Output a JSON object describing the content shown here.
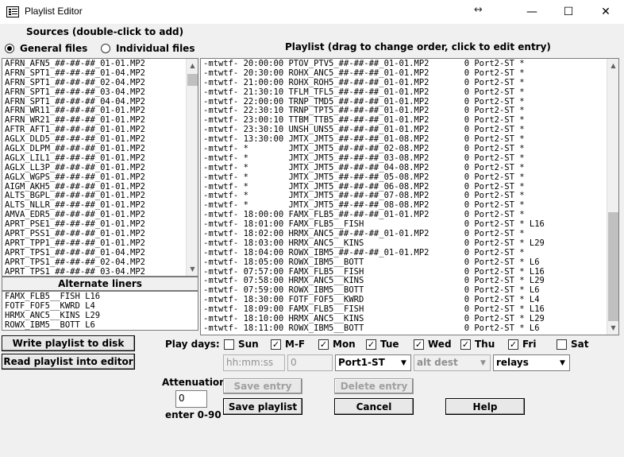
{
  "window": {
    "title": "Playlist Editor",
    "resize_glyph": "↔",
    "minimize": "—",
    "maximize": "☐",
    "close": "✕"
  },
  "sources": {
    "heading": "Sources (double-click to add)",
    "radio_general": "General files",
    "radio_individual": "Individual files",
    "selected": "general",
    "files": [
      "AFRN_AFN5_##-##-##_01-01.MP2",
      "AFRN_SPT1_##-##-##_01-04.MP2",
      "AFRN_SPT1_##-##-##_02-04.MP2",
      "AFRN_SPT1_##-##-##_03-04.MP2",
      "AFRN_SPT1_##-##-##_04-04.MP2",
      "AFRN_WR11_##-##-##_01-01.MP2",
      "AFRN_WR21_##-##-##_01-01.MP2",
      "AFTR_AFT1_##-##-##_01-01.MP2",
      "AGLX_DLD5_##-##-##_01-01.MP2",
      "AGLX_DLPM_##-##-##_01-01.MP2",
      "AGLX_LIL1_##-##-##_01-01.MP2",
      "AGLX_LL3P_##-##-##_01-01.MP2",
      "AGLX_WGPS_##-##-##_01-01.MP2",
      "AIGM_AKH5_##-##-##_01-01.MP2",
      "ALTS_BGPL_##-##-##_01-01.MP2",
      "ALTS_NLLR_##-##-##_01-01.MP2",
      "AMVA_EDR5_##-##-##_01-01.MP2",
      "APRT_PSE1_##-##-##_01-01.MP2",
      "APRT_PSS1_##-##-##_01-01.MP2",
      "APRT_TPP1_##-##-##_01-01.MP2",
      "APRT_TPS1_##-##-##_01-04.MP2",
      "APRT_TPS1_##-##-##_02-04.MP2",
      "APRT_TPS1_##-##-##_03-04.MP2"
    ]
  },
  "liners": {
    "heading": "Alternate liners",
    "items": [
      "FAMX_FLB5__FISH L16",
      "FOTF_FOF5__KWRD L4",
      "HRMX_ANC5__KINS L29",
      "ROWX_IBM5__BOTT L6"
    ]
  },
  "playlist": {
    "heading": "Playlist (drag to change order, click to edit entry)",
    "entries": [
      "-mtwtf- 20:00:00 PTOV_PTV5_##-##-##_01-01.MP2       0 Port2-ST *",
      "-mtwtf- 20:30:00 ROHX_ANC5_##-##-##_01-01.MP2       0 Port2-ST *",
      "-mtwtf- 21:00:00 ROHX_ROH5_##-##-##_01-01.MP2       0 Port2-ST *",
      "-mtwtf- 21:30:10 TFLM_TFL5_##-##-##_01-01.MP2       0 Port2-ST *",
      "-mtwtf- 22:00:00 TRNP_TMD5_##-##-##_01-01.MP2       0 Port2-ST *",
      "-mtwtf- 22:30:10 TRNP_TPT5_##-##-##_01-01.MP2       0 Port2-ST *",
      "-mtwtf- 23:00:10 TTBM_TTB5_##-##-##_01-01.MP2       0 Port2-ST *",
      "-mtwtf- 23:30:10 UNSH_UNS5_##-##-##_01-01.MP2       0 Port2-ST *",
      "-mtwtf- 13:30:00 JMTX_JMT5_##-##-##_01-08.MP2       0 Port2-ST *",
      "-mtwtf- *        JMTX_JMT5_##-##-##_02-08.MP2       0 Port2-ST *",
      "-mtwtf- *        JMTX_JMT5_##-##-##_03-08.MP2       0 Port2-ST *",
      "-mtwtf- *        JMTX_JMT5_##-##-##_04-08.MP2       0 Port2-ST *",
      "-mtwtf- *        JMTX_JMT5_##-##-##_05-08.MP2       0 Port2-ST *",
      "-mtwtf- *        JMTX_JMT5_##-##-##_06-08.MP2       0 Port2-ST *",
      "-mtwtf- *        JMTX_JMT5_##-##-##_07-08.MP2       0 Port2-ST *",
      "-mtwtf- *        JMTX_JMT5_##-##-##_08-08.MP2       0 Port2-ST *",
      "-mtwtf- 18:00:00 FAMX_FLB5_##-##-##_01-01.MP2       0 Port2-ST *",
      "-mtwtf- 18:01:00 FAMX_FLB5__FISH                    0 Port2-ST * L16",
      "-mtwtf- 18:02:00 HRMX_ANC5_##-##-##_01-01.MP2       0 Port2-ST *",
      "-mtwtf- 18:03:00 HRMX_ANC5__KINS                    0 Port2-ST * L29",
      "-mtwtf- 18:04:00 ROWX_IBM5_##-##-##_01-01.MP2       0 Port2-ST *",
      "-mtwtf- 18:05:00 ROWX_IBM5__BOTT                    0 Port2-ST * L6",
      "-mtwtf- 07:57:00 FAMX_FLB5__FISH                    0 Port2-ST * L16",
      "-mtwtf- 07:58:00 HRMX_ANC5__KINS                    0 Port2-ST * L29",
      "-mtwtf- 07:59:00 ROWX_IBM5__BOTT                    0 Port2-ST * L6",
      "-mtwtf- 18:30:00 FOTF_FOF5__KWRD                    0 Port2-ST * L4",
      "-mtwtf- 18:09:00 FAMX_FLB5__FISH                    0 Port2-ST * L16",
      "-mtwtf- 18:10:00 HRMX_ANC5__KINS                    0 Port2-ST * L29",
      "-mtwtf- 18:11:00 ROWX_IBM5__BOTT                    0 Port2-ST * L6"
    ]
  },
  "buttons": {
    "write": "Write playlist to disk",
    "read": "Read playlist into editor",
    "save_entry": "Save entry",
    "delete_entry": "Delete entry",
    "save_playlist": "Save playlist",
    "cancel": "Cancel",
    "help": "Help"
  },
  "play_days": {
    "label": "Play days:",
    "days": [
      {
        "label": "Sun",
        "checked": false,
        "mark": ""
      },
      {
        "label": "M-F",
        "checked": true,
        "mark": "✓"
      },
      {
        "label": "Mon",
        "checked": true,
        "mark": "✓"
      },
      {
        "label": "Tue",
        "checked": true,
        "mark": "✓"
      },
      {
        "label": "Wed",
        "checked": true,
        "mark": "✓"
      },
      {
        "label": "Thu",
        "checked": true,
        "mark": "✓"
      },
      {
        "label": "Fri",
        "checked": true,
        "mark": "✓"
      },
      {
        "label": "Sat",
        "checked": false,
        "mark": ""
      }
    ]
  },
  "entry_fields": {
    "time_placeholder": "hh:mm:ss",
    "attenuation_value": "0",
    "port": "Port1-ST",
    "alt_dest": "alt dest",
    "relays": "relays",
    "dropdown_glyph": "▼"
  },
  "attenuation": {
    "label": "Attenuation",
    "value": "0",
    "hint": "enter 0-90"
  },
  "scroll_glyphs": {
    "up": "▲",
    "down": "▼"
  }
}
